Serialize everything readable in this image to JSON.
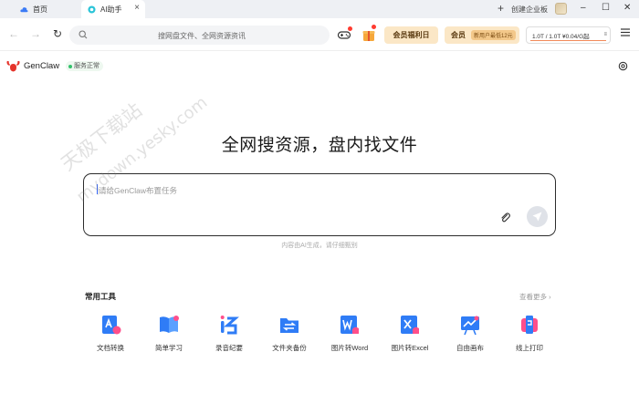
{
  "tabs": [
    {
      "label": "首页",
      "icon": "cloud-icon",
      "active": false
    },
    {
      "label": "AI助手",
      "icon": "ai-assistant-icon",
      "active": true
    }
  ],
  "titlebar": {
    "new_tab": "+",
    "create_enterprise": "创建企业板",
    "minimize": "–",
    "maximize": "☐",
    "close": "✕"
  },
  "toolbar": {
    "back": "←",
    "forward": "→",
    "refresh": "↻",
    "search_placeholder": "搜网盘文件、全网资源资讯",
    "welfare_label": "会员福利日",
    "member_label": "会员",
    "member_promo": "新用户最低12元",
    "storage_text": "1.0T / 1.0T  ¥0.04/G起",
    "storage_more": "≡"
  },
  "app": {
    "brand": "GenClaw",
    "status": "服务正常"
  },
  "main": {
    "hero": "全网搜资源，盘内找文件",
    "task_placeholder": "请给GenClaw布置任务",
    "disclaimer": "内容由AI生成，请仔细甄别"
  },
  "tools": {
    "title": "常用工具",
    "see_more": "查看更多 ›",
    "items": [
      {
        "label": "文档转换",
        "icon": "doc-convert-icon"
      },
      {
        "label": "简单学习",
        "icon": "book-study-icon"
      },
      {
        "label": "录音纪要",
        "icon": "recording-notes-icon"
      },
      {
        "label": "文件夹备份",
        "icon": "folder-backup-icon"
      },
      {
        "label": "图片转Word",
        "icon": "image-to-word-icon"
      },
      {
        "label": "图片转Excel",
        "icon": "image-to-excel-icon"
      },
      {
        "label": "自由画布",
        "icon": "free-canvas-icon"
      },
      {
        "label": "线上打印",
        "icon": "online-print-icon"
      }
    ]
  },
  "watermark": {
    "line1": "天极下载站",
    "line2": "mydown.yesky.com"
  },
  "colors": {
    "accent_blue": "#2f7cf6",
    "accent_pink": "#ff4f8b",
    "status_green": "#33c26b",
    "member_gold": "#fbe7c6"
  }
}
